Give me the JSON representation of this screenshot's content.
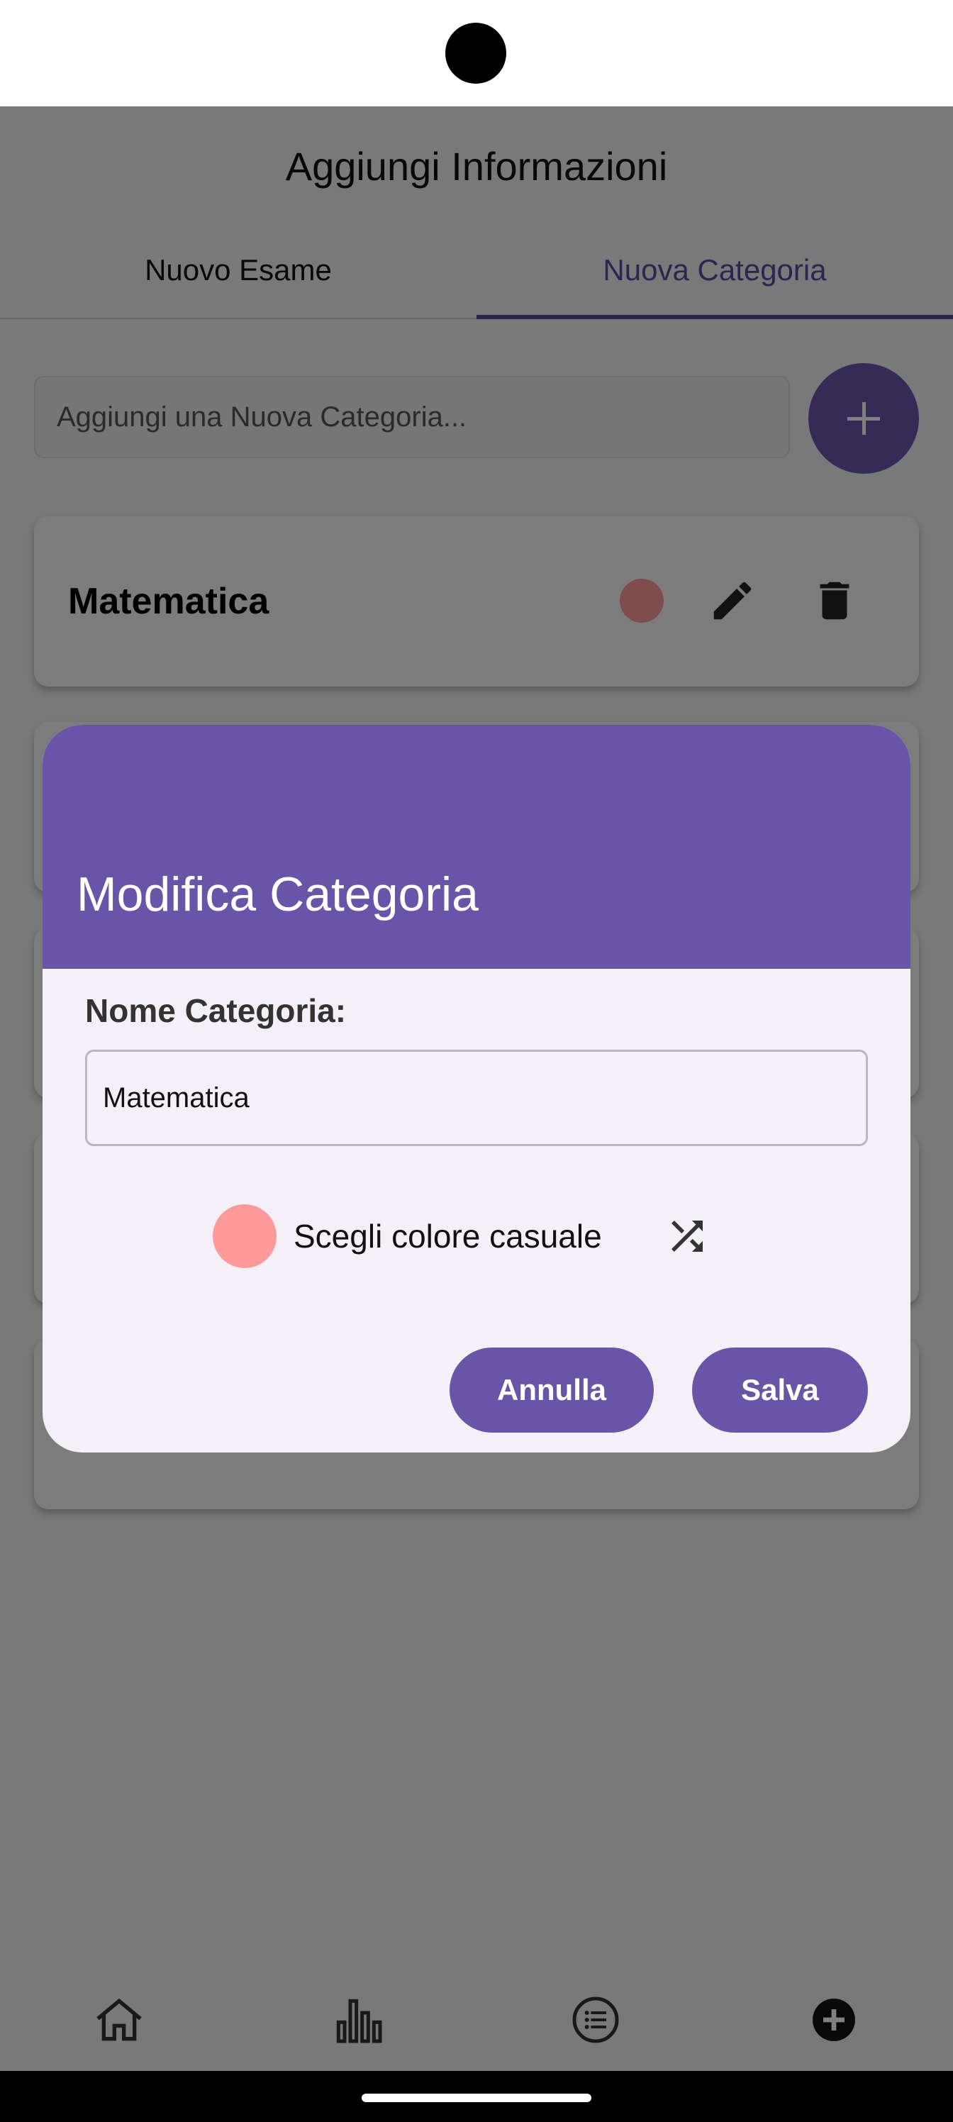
{
  "screen": {
    "title": "Aggiungi Informazioni",
    "tabs": [
      {
        "label": "Nuovo Esame",
        "active": false
      },
      {
        "label": "Nuova Categoria",
        "active": true
      }
    ],
    "new_category_input": {
      "placeholder": "Aggiungi una Nuova Categoria...",
      "value": ""
    },
    "add_button_icon": "plus-icon",
    "categories": [
      {
        "name": "Matematica",
        "color": "#ff9a9a"
      }
    ],
    "accent_color": "#6955a8"
  },
  "dialog": {
    "title": "Modifica Categoria",
    "field_label": "Nome Categoria:",
    "field_value": "Matematica",
    "color_label": "Scegli colore casuale",
    "selected_color": "#ff9a9a",
    "shuffle_icon": "shuffle-icon",
    "cancel_label": "Annulla",
    "save_label": "Salva"
  },
  "bottom_nav": [
    {
      "icon": "home-icon"
    },
    {
      "icon": "bar-chart-icon"
    },
    {
      "icon": "list-icon"
    },
    {
      "icon": "add-circle-icon",
      "active": true
    }
  ]
}
